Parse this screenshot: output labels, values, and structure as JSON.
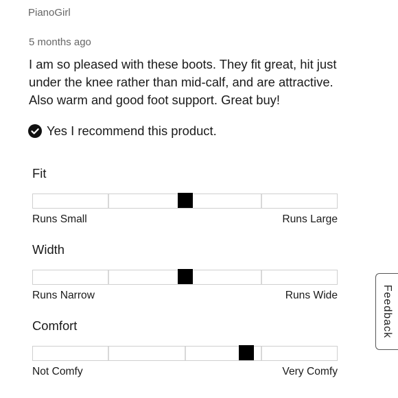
{
  "review": {
    "author": "PianoGirl",
    "timestamp": "5 months ago",
    "body": "I am so pleased with these boots. They fit great, hit just under the knee rather than mid-calf, and are attractive. Also warm and good foot support. Great buy!",
    "recommend_text": "Yes I recommend this product.",
    "recommend_icon": "check-circle-icon"
  },
  "ratings": [
    {
      "title": "Fit",
      "min_label": "Runs Small",
      "max_label": "Runs Large",
      "value": 3,
      "scale": 5
    },
    {
      "title": "Width",
      "min_label": "Runs Narrow",
      "max_label": "Runs Wide",
      "value": 3,
      "scale": 5
    },
    {
      "title": "Comfort",
      "min_label": "Not Comfy",
      "max_label": "Very Comfy",
      "value": 4,
      "scale": 5
    }
  ],
  "feedback_tab": {
    "label": "Feedback"
  },
  "colors": {
    "marker": "#000000",
    "track_border": "#cfcfcf",
    "meta_text": "#666666"
  }
}
